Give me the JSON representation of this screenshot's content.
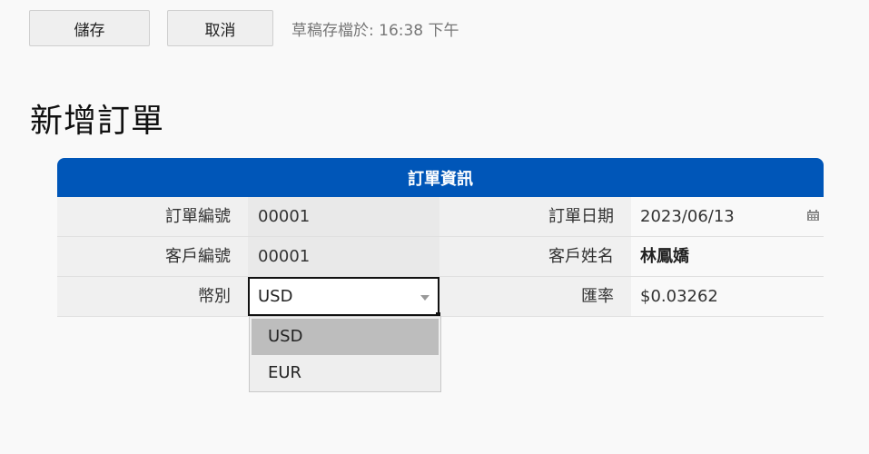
{
  "toolbar": {
    "save_label": "儲存",
    "cancel_label": "取消",
    "draft_status": "草稿存檔於: 16:38 下午"
  },
  "page": {
    "title": "新增訂單"
  },
  "order_info": {
    "header": "訂單資訊",
    "order_number_label": "訂單編號",
    "order_number_value": "00001",
    "order_date_label": "訂單日期",
    "order_date_value": "2023/06/13",
    "customer_number_label": "客戶編號",
    "customer_number_value": "00001",
    "customer_name_label": "客戶姓名",
    "customer_name_value": "林鳳嬌",
    "currency_label": "幣別",
    "currency_value": "USD",
    "exchange_rate_label": "匯率",
    "exchange_rate_value": "$0.03262"
  },
  "currency_dropdown": {
    "options": [
      "USD",
      "EUR"
    ],
    "highlighted": "USD"
  },
  "colors": {
    "header_blue": "#0056b8",
    "selected_option": "#bdbdbd"
  },
  "icons": {
    "date_picker": "calendar-icon",
    "select_caret": "caret-down-icon"
  }
}
